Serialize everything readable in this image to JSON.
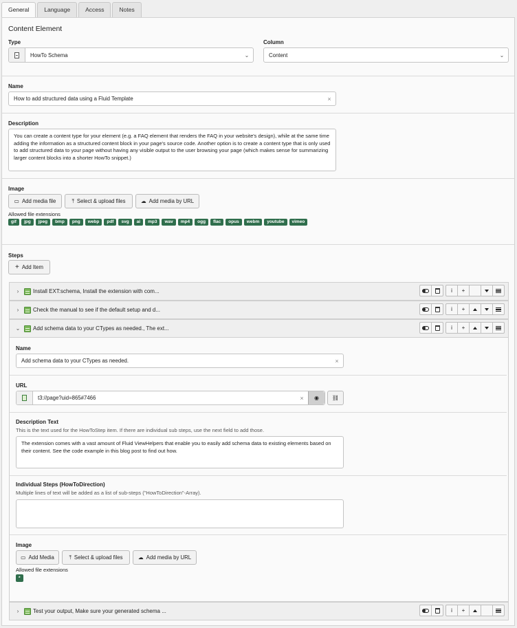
{
  "tabs": [
    "General",
    "Language",
    "Access",
    "Notes"
  ],
  "section_title": "Content Element",
  "type": {
    "label": "Type",
    "value": "HowTo Schema",
    "icon": "content-type-icon"
  },
  "column": {
    "label": "Column",
    "value": "Content"
  },
  "name": {
    "label": "Name",
    "value": "How to add structured data using a Fluid Template"
  },
  "description": {
    "label": "Description",
    "value": "You can create a content type for your element (e.g. a FAQ element that renders the FAQ in your website's design), while at the same time adding the information as a structured content block in your page's source code. Another option is to create a content type that is only used to add structured data to your page without having any visible output to the user browsing your page (which makes sense for summarizing larger content blocks into a shorter HowTo snippet.)"
  },
  "image": {
    "label": "Image",
    "buttons": [
      "Add media file",
      "Select & upload files",
      "Add media by URL"
    ],
    "allowed_label": "Allowed file extensions",
    "extensions": [
      "gif",
      "jpg",
      "jpeg",
      "bmp",
      "png",
      "webp",
      "pdf",
      "svg",
      "ai",
      "mp3",
      "wav",
      "mp4",
      "ogg",
      "flac",
      "opus",
      "webm",
      "youtube",
      "vimeo"
    ]
  },
  "steps": {
    "label": "Steps",
    "add_label": "Add Item",
    "items": [
      {
        "title": "Install EXT:schema, Install the extension with com..."
      },
      {
        "title": "Check the manual to see if the default setup and d..."
      },
      {
        "title": "Add schema data to your CTypes as needed., The ext..."
      },
      {
        "title": "Test your output, Make sure your generated schema ..."
      }
    ],
    "expanded": {
      "name_label": "Name",
      "name_value": "Add schema data to your CTypes as needed.",
      "url_label": "URL",
      "url_value": "t3://page?uid=865#7466",
      "desc_label": "Description Text",
      "desc_help": "This is the text used for the HowToStep item. If there are individual sub steps, use the next field to add those.",
      "desc_value": "The extension comes with a vast amount of Fluid ViewHelpers that enable you to easily add schema data to existing elements based on their content. See the code example in this blog post to find out how.",
      "ind_label": "Individual Steps (HowToDirection)",
      "ind_help": "Multiple lines of text will be added as a list of sub-steps (\"HowToDirection\"-Array).",
      "image_label": "Image",
      "image_buttons": [
        "Add Media",
        "Select & upload files",
        "Add media by URL"
      ],
      "allowed_label": "Allowed file extensions",
      "allowed_value": "*"
    }
  },
  "glyphs": {
    "clear": "×",
    "plus": "+",
    "info": "i",
    "collapsed": "›",
    "expanded": "⌄",
    "select": "⌄"
  }
}
